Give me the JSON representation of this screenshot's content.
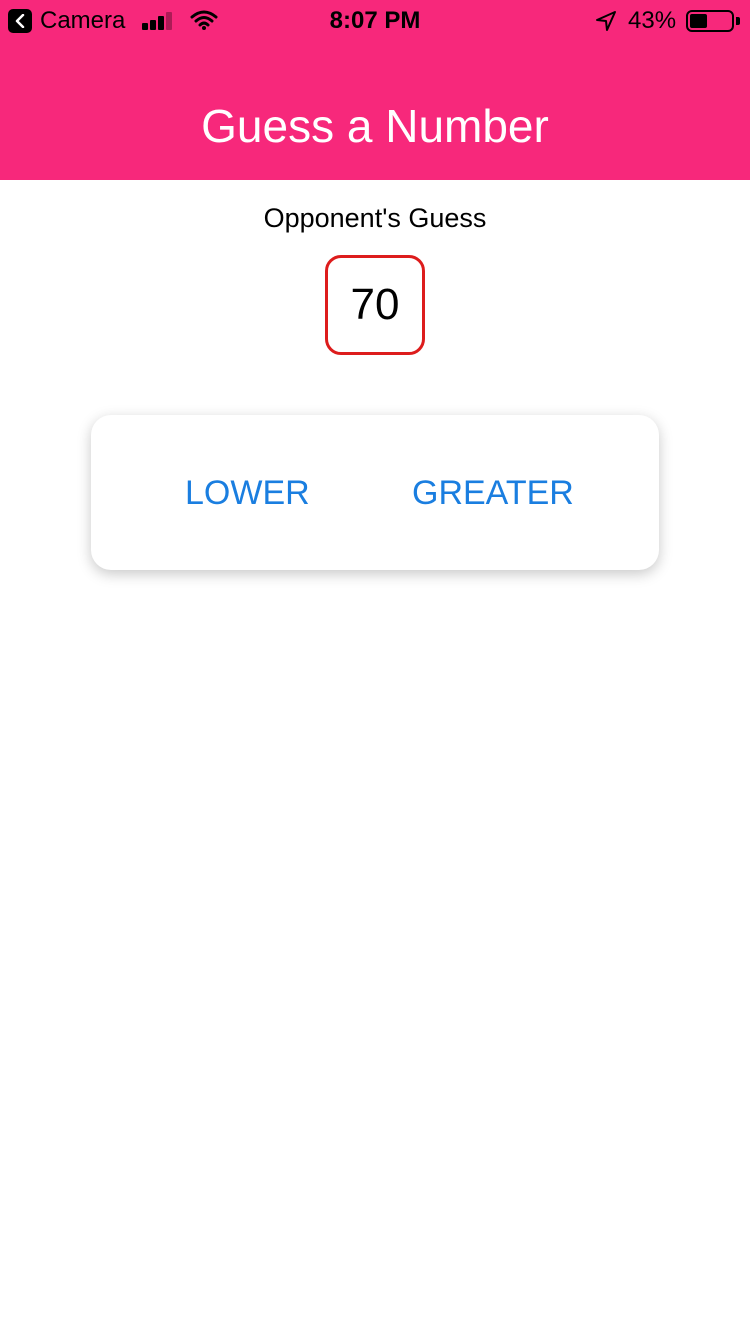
{
  "status_bar": {
    "back_app": "Camera",
    "time": "8:07 PM",
    "battery_percent": "43%",
    "battery_level": 0.43
  },
  "header": {
    "title": "Guess a Number",
    "background_color": "#f7287b"
  },
  "game": {
    "label": "Opponent's Guess",
    "guess": "70"
  },
  "buttons": {
    "lower": "LOWER",
    "greater": "GREATER",
    "color": "#1a7ee0"
  }
}
